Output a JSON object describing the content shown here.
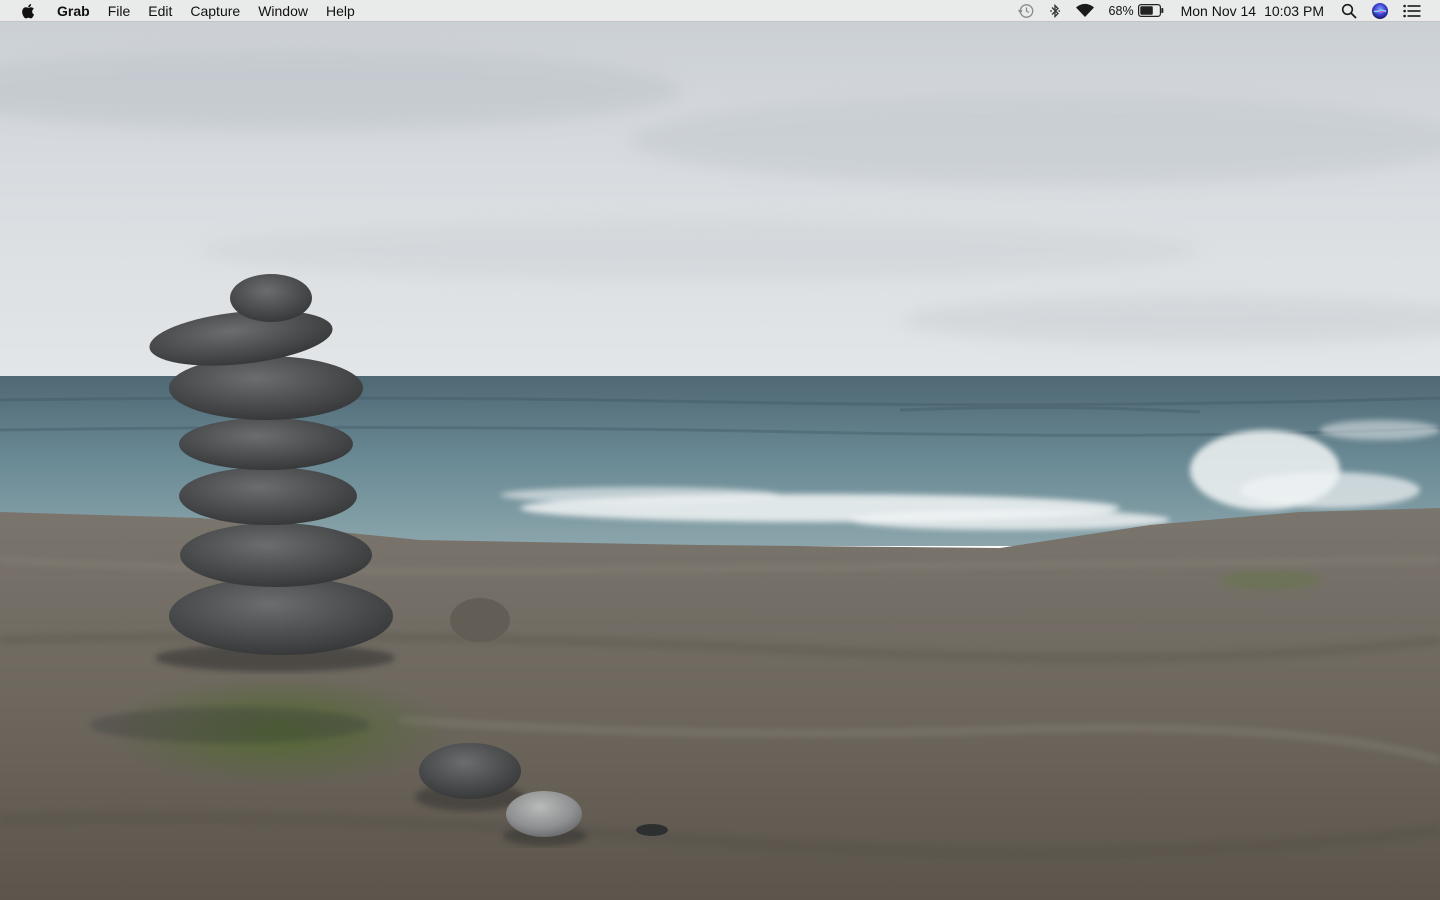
{
  "menubar": {
    "apple_icon": "apple-logo-icon",
    "app_name": "Grab",
    "menus": [
      "File",
      "Edit",
      "Capture",
      "Window",
      "Help"
    ],
    "status": {
      "time_machine_icon": "time-machine-icon",
      "bluetooth_icon": "bluetooth-icon",
      "wifi_icon": "wifi-icon",
      "battery_percent": "68%",
      "battery_level": 0.68,
      "battery_icon": "battery-icon",
      "date": "Mon Nov 14",
      "time": "10:03 PM",
      "spotlight_icon": "search-icon",
      "siri_icon": "siri-icon",
      "notification_icon": "notification-center-icon"
    }
  },
  "desktop": {
    "wallpaper_subject": "stacked-stones-beach"
  },
  "colors": {
    "menubar_bg": "#ececec",
    "sky": "#d6dade",
    "ocean": "#5e7c88",
    "rock": "#6f6a60"
  }
}
